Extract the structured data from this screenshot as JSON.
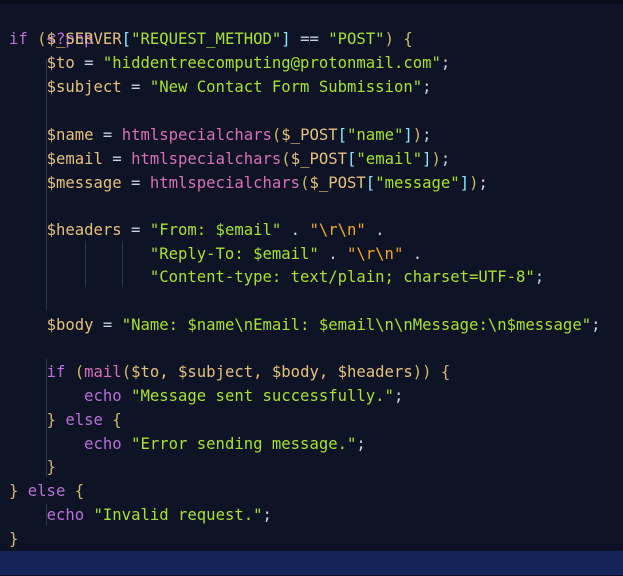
{
  "editor": {
    "language": "php",
    "colors": {
      "background": "#0e1426",
      "current_line": "#14245a",
      "keyword": "#b96fd6",
      "variable": "#e5c07b",
      "string": "#a6e22e",
      "escape": "#f5a623",
      "function": "#d86fb8"
    },
    "code": {
      "l01": "<?php",
      "l02_kw": "if",
      "l02_var": "$_SERVER",
      "l02_key": "\"REQUEST_METHOD\"",
      "l02_op": "==",
      "l02_val": "\"POST\"",
      "l03_var": "$to",
      "l03_val": "\"hiddentreecomputing@protonmail.com\"",
      "l04_var": "$subject",
      "l04_val": "\"New Contact Form Submission\"",
      "l06_var": "$name",
      "l06_fn": "htmlspecialchars",
      "l06_arr": "$_POST",
      "l06_key": "\"name\"",
      "l07_var": "$email",
      "l07_fn": "htmlspecialchars",
      "l07_arr": "$_POST",
      "l07_key": "\"email\"",
      "l08_var": "$message",
      "l08_fn": "htmlspecialchars",
      "l08_arr": "$_POST",
      "l08_key": "\"message\"",
      "l10_var": "$headers",
      "l10_a": "\"From: $email\"",
      "l10_b": "\"\\r\\n\"",
      "l11_a": "\"Reply-To: $email\"",
      "l11_b": "\"\\r\\n\"",
      "l12_a": "\"Content-type: text/plain; charset=UTF-8\"",
      "l14_var": "$body",
      "l14_val": "\"Name: $name\\nEmail: $email\\n\\nMessage:\\n$message\"",
      "l16_kw": "if",
      "l16_fn": "mail",
      "l16_args": "$to, $subject, $body, $headers",
      "l17_kw": "echo",
      "l17_val": "\"Message sent successfully.\"",
      "l18_kw": "else",
      "l19_kw": "echo",
      "l19_val": "\"Error sending message.\"",
      "l21_kw": "else",
      "l22_kw": "echo",
      "l22_val": "\"Invalid request.\"",
      "l24": "?>"
    }
  }
}
